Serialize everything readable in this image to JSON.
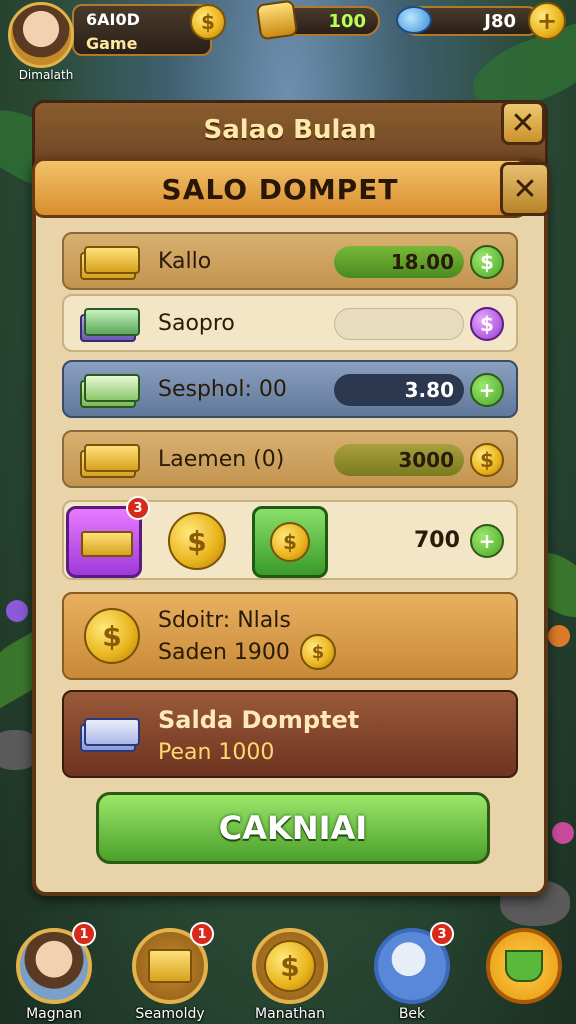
{
  "hud": {
    "player_name": "6AI0D",
    "player_sub": "Game",
    "avatar_label": "Dimalath",
    "gold_value": "100",
    "gem_value": "J80",
    "plus": "+"
  },
  "outer_panel": {
    "title": "Salao Bulan",
    "close": "✕"
  },
  "wallet": {
    "title": "SALO DOMPET",
    "close": "✕",
    "rows": [
      {
        "label": "Kallo",
        "value": "18.00",
        "action": "$"
      },
      {
        "label": "Saopro",
        "value": "",
        "action": "$"
      },
      {
        "label": "Sesphol: 00",
        "value": "3.80",
        "action": "+"
      },
      {
        "label": "Laemen (0)",
        "value": "3000",
        "action": "$"
      }
    ],
    "bundle": {
      "badge": "3",
      "value": "700",
      "action": "+"
    },
    "offer1": {
      "line1": "Sdoitr: Nlals",
      "line2": "Saden 1900"
    },
    "offer2": {
      "line1": "Salda Domptet",
      "line2": "Pean 1000"
    },
    "cta": "CAKNIAI"
  },
  "nav": [
    {
      "label": "Magnan",
      "badge": "1",
      "icon": "avatar-icon"
    },
    {
      "label": "Seamoldy",
      "badge": "1",
      "icon": "gold-bars-icon"
    },
    {
      "label": "Manathan",
      "badge": "",
      "icon": "coin-icon"
    },
    {
      "label": "Bek",
      "badge": "3",
      "icon": "creature-icon"
    },
    {
      "label": "",
      "badge": "",
      "icon": "cauldron-icon"
    }
  ]
}
